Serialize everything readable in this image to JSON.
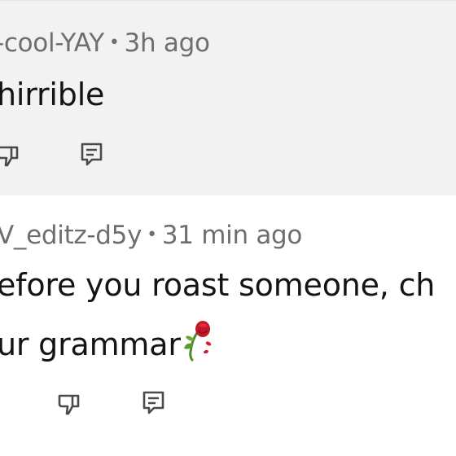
{
  "comments": [
    {
      "author": "-cool-YAY",
      "separator": "•",
      "time": "3h ago",
      "lines": [
        "hirrible"
      ],
      "icons": [
        "dislike-icon",
        "reply-icon"
      ]
    },
    {
      "author": "V_editz-d5y",
      "separator": "•",
      "time": "31 min ago",
      "lines": [
        "efore you roast someone, ch",
        "ur grammar"
      ],
      "emoji": "wilted-rose-emoji",
      "icons": [
        "dislike-icon",
        "reply-icon"
      ]
    }
  ],
  "colors": {
    "comment1_bg": "#f2f2f2",
    "comment2_bg": "#ffffff",
    "meta_text": "#6e6e6e",
    "body_text": "#141414",
    "icon_stroke": "#4a4a4a"
  }
}
